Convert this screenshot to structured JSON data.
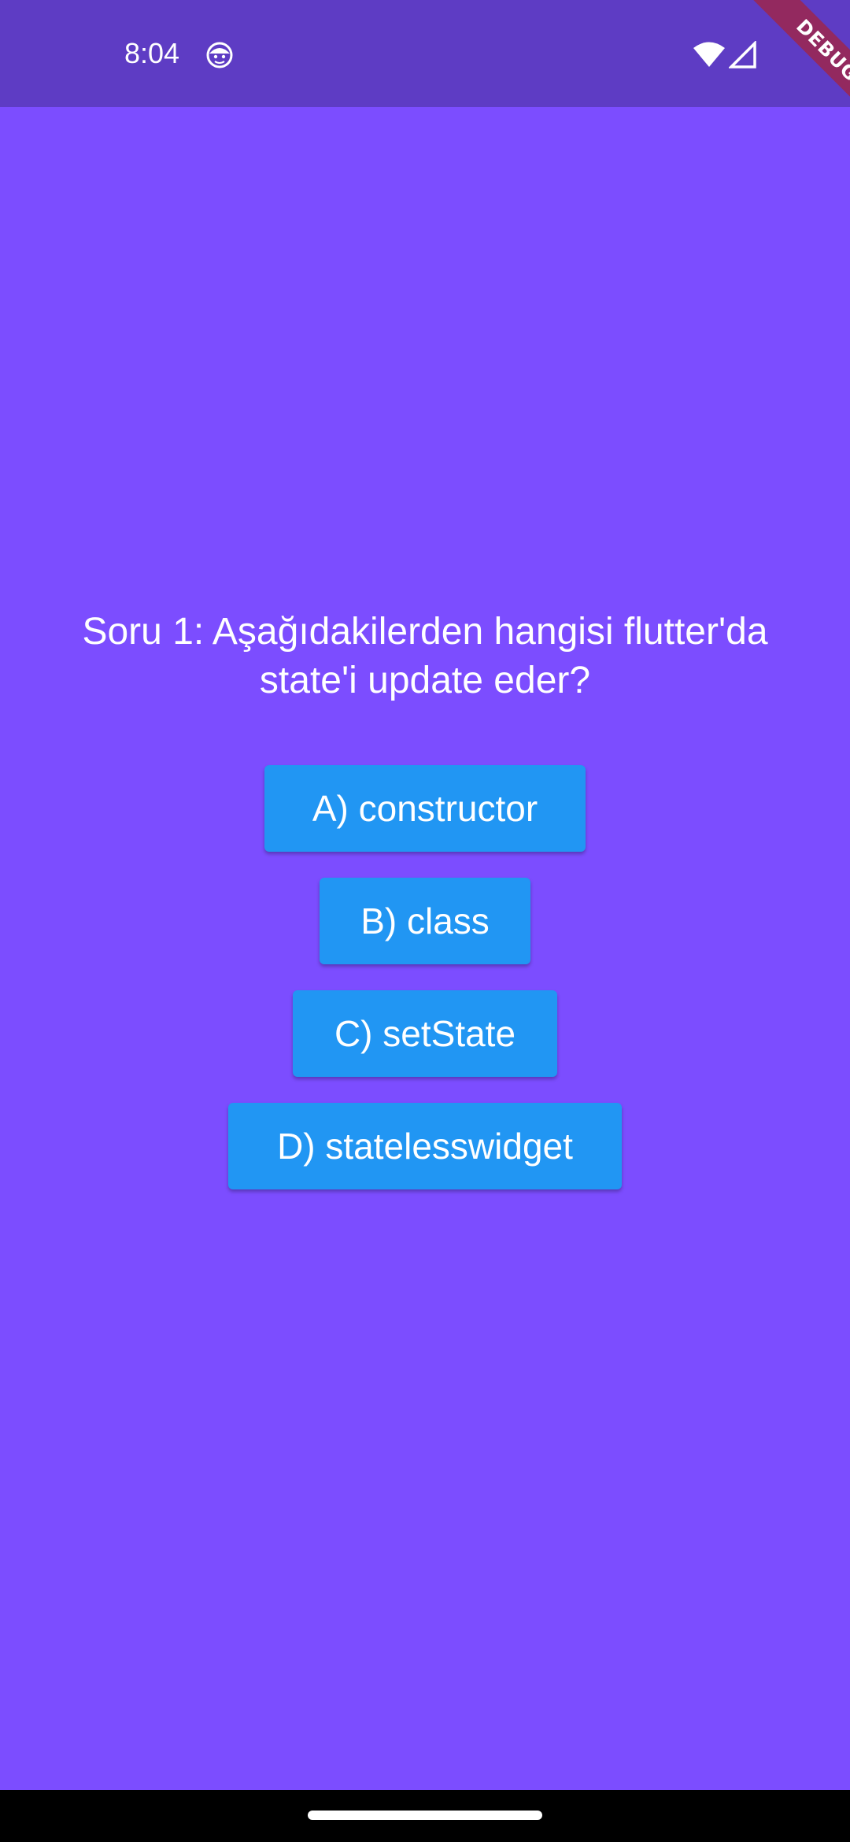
{
  "status_bar": {
    "time": "8:04",
    "background": "#5e3cc4"
  },
  "debug_banner": {
    "label": "DEBUG"
  },
  "quiz": {
    "question": "Soru 1: Aşağıdakilerden hangisi flutter'da state'i update eder?",
    "answers": [
      {
        "label": "A) constructor"
      },
      {
        "label": "B) class"
      },
      {
        "label": "C) setState"
      },
      {
        "label": "D) statelesswidget"
      }
    ]
  },
  "colors": {
    "background": "#7c4dff",
    "button": "#2196f3",
    "text": "#ffffff"
  },
  "icons": [
    "face-icon",
    "wifi-icon",
    "signal-icon"
  ]
}
